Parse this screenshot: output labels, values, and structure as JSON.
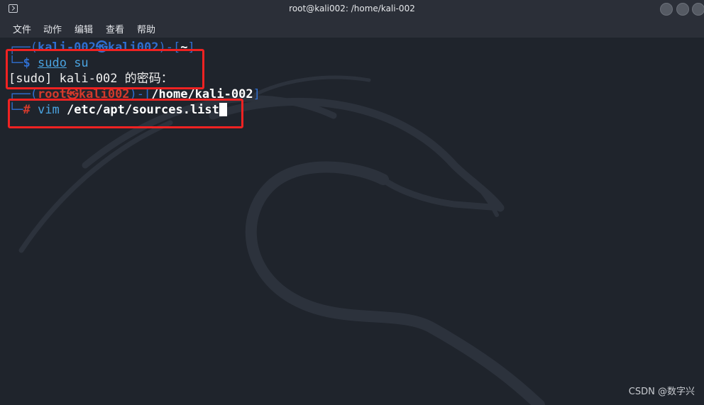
{
  "window": {
    "title": "root@kali002: /home/kali-002",
    "icon": "terminal-icon",
    "controls": [
      "minimize-button",
      "maximize-button",
      "close-button"
    ]
  },
  "menubar": {
    "items": [
      "文件",
      "动作",
      "编辑",
      "查看",
      "帮助"
    ]
  },
  "terminal": {
    "line1": {
      "open": "┌──(",
      "user": "kali-002㉿kali002",
      "close": ")-[",
      "dir": "~",
      "end": "]"
    },
    "line2": {
      "corner": "└─",
      "prompt": "$",
      "cmd": "sudo",
      "arg": "su"
    },
    "line3": {
      "text": "[sudo] kali-002 的密码："
    },
    "line4": {
      "open": "┌──(",
      "user": "root㉿kali002",
      "close": ")-[",
      "dir": "/home/kali-002",
      "end": "]"
    },
    "line5": {
      "corner": "└─",
      "prompt": "#",
      "cmd": "vim",
      "arg": "/etc/apt/sources.list"
    }
  },
  "watermark": "CSDN @数字兴",
  "colors": {
    "background": "#1f242c",
    "titlebar": "#2b2f38",
    "prompt_blue": "#2f6fd1",
    "prompt_red": "#d33a2c",
    "highlight_red": "#f02222"
  }
}
